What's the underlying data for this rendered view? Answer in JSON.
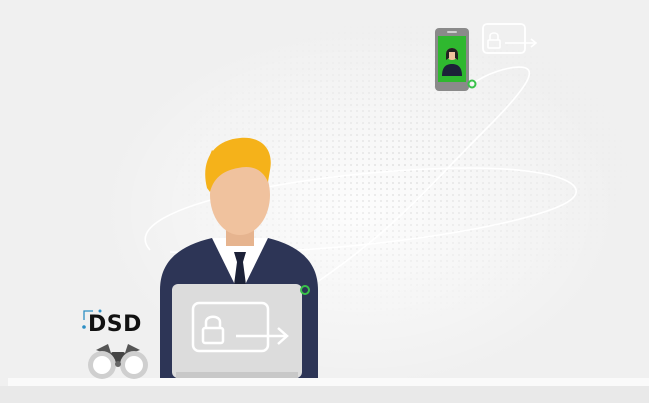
{
  "brand": {
    "logo_text": "DSD",
    "accent_color": "#2b8ec4"
  },
  "illustration": {
    "icons": [
      "person-icon",
      "laptop-icon",
      "lock-icon",
      "arrow-right-icon",
      "smartphone-icon",
      "binoculars-icon"
    ],
    "colors": {
      "background": "#f0f0f0",
      "suit": "#2d3556",
      "hair": "#f5b21a",
      "skin": "#f0c29e",
      "laptop": "#dcdcdc",
      "phone_screen": "#2fb82f",
      "connector_dot": "#39c24a"
    }
  }
}
